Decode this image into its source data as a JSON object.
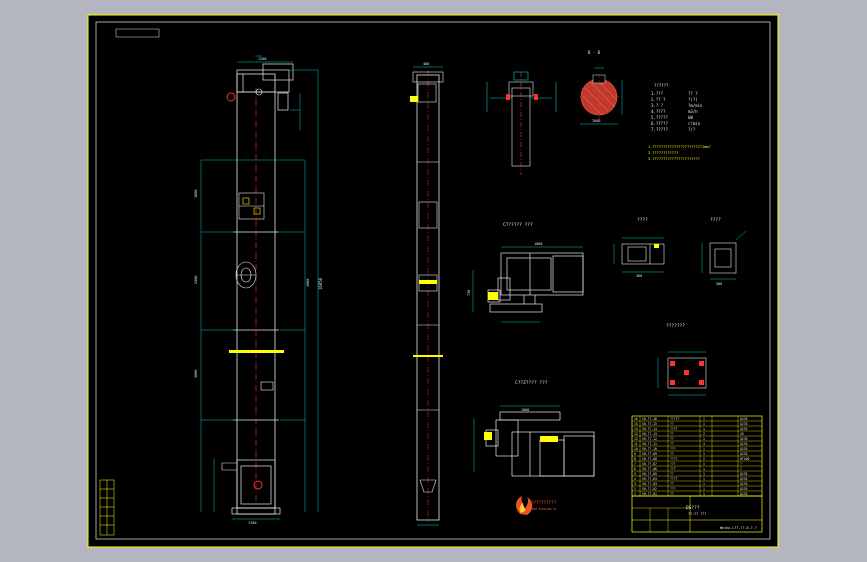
{
  "drawing": {
    "section_label": "B - B",
    "tech_heading": "??????",
    "tech_params": [
      {
        "k": "1.???",
        "v": "?? ?"
      },
      {
        "k": "2.?? ?",
        "v": "?(?)"
      },
      {
        "k": "3.?   ?",
        "v": "?m/min"
      },
      {
        "k": "4.????",
        "v": "m3/h"
      },
      {
        "k": "5.?????",
        "v": "kW"
      },
      {
        "k": "6.?????",
        "v": "r/min"
      },
      {
        "k": "7.?????",
        "v": "?/?"
      }
    ],
    "notes": [
      "1.???????????????????????1mm?",
      "2.????????????",
      "3.??????????????????????"
    ],
    "view_head_drive": "C??????  ???",
    "view_a": "????",
    "view_b": "????",
    "view_base": "???????",
    "view_tail_drive": "C??Z????  ???",
    "company_name": "??????????",
    "company_sub": "HIGH ELEVATOR CO.",
    "title_block": {
      "drawing_name": "DS???",
      "scale": "??:?? ???",
      "drawing_no": "Weiho-LTT-??-0-?.?"
    },
    "bom_rows": [
      {
        "n": "16",
        "code": "SH-??-16",
        "name": "?????",
        "q": "1",
        "m": "Q235"
      },
      {
        "n": "15",
        "code": "SH-??-15",
        "name": "??",
        "q": "1",
        "m": "Q235"
      },
      {
        "n": "14",
        "code": "SH-??-14",
        "name": "????",
        "q": "1",
        "m": "Q235"
      },
      {
        "n": "13",
        "code": "SH-??-13",
        "name": "??",
        "q": "2",
        "m": "45"
      },
      {
        "n": "12",
        "code": "SH-??-12",
        "name": "??",
        "q": "1",
        "m": "Q235"
      },
      {
        "n": "11",
        "code": "SH-??-11",
        "name": "??",
        "q": "4",
        "m": "Q235"
      },
      {
        "n": "10",
        "code": "SH-??-10",
        "name": "???",
        "q": "1",
        "m": "Q235"
      },
      {
        "n": "9",
        "code": "SH-??-09",
        "name": "??",
        "q": "1",
        "m": "Q235"
      },
      {
        "n": "8",
        "code": "SH-??-08",
        "name": "????",
        "q": "2",
        "m": "HT200"
      },
      {
        "n": "7",
        "code": "SH-??-07",
        "name": "???",
        "q": "1",
        "m": "?"
      },
      {
        "n": "6",
        "code": "SH-??-06",
        "name": "???",
        "q": "1",
        "m": "?"
      },
      {
        "n": "5",
        "code": "SH-??-05",
        "name": "??",
        "q": "1",
        "m": "Q235"
      },
      {
        "n": "4",
        "code": "SH-??-04",
        "name": "????",
        "q": "1",
        "m": "Q235"
      },
      {
        "n": "3",
        "code": "SH-??-03",
        "name": "??",
        "q": "1",
        "m": "Q235"
      },
      {
        "n": "2",
        "code": "SH-??-02",
        "name": "???",
        "q": "1",
        "m": "Q235"
      },
      {
        "n": "1",
        "code": "SH-??-01",
        "name": "??",
        "q": "1",
        "m": "Q235"
      }
    ],
    "dims": {
      "total_height": "16850",
      "seg_a": "1800",
      "seg_b": "2400",
      "seg_c": "3000",
      "seg_d": "2600",
      "head_w": "1200",
      "boot_w": "1700",
      "side_w": "480",
      "drive_w": "1060",
      "drive_h": "730",
      "small_a": "360",
      "small_b": "300",
      "dia": "?600",
      "tail_w": "1000"
    }
  }
}
